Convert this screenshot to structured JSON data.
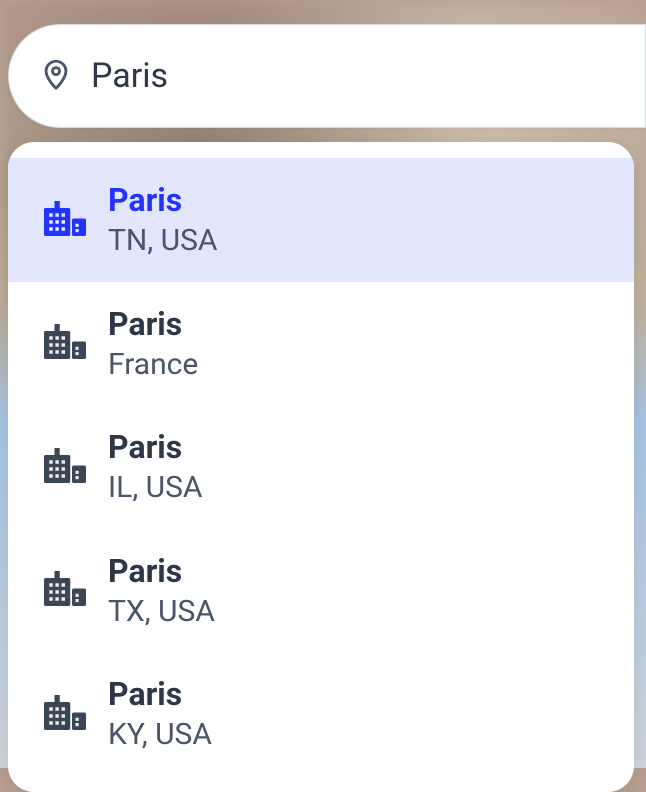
{
  "search": {
    "value": "Paris"
  },
  "suggestions": [
    {
      "name": "Paris",
      "sub": "TN, USA",
      "highlighted": true
    },
    {
      "name": "Paris",
      "sub": "France",
      "highlighted": false
    },
    {
      "name": "Paris",
      "sub": "IL, USA",
      "highlighted": false
    },
    {
      "name": "Paris",
      "sub": "TX, USA",
      "highlighted": false
    },
    {
      "name": "Paris",
      "sub": "KY, USA",
      "highlighted": false
    }
  ]
}
